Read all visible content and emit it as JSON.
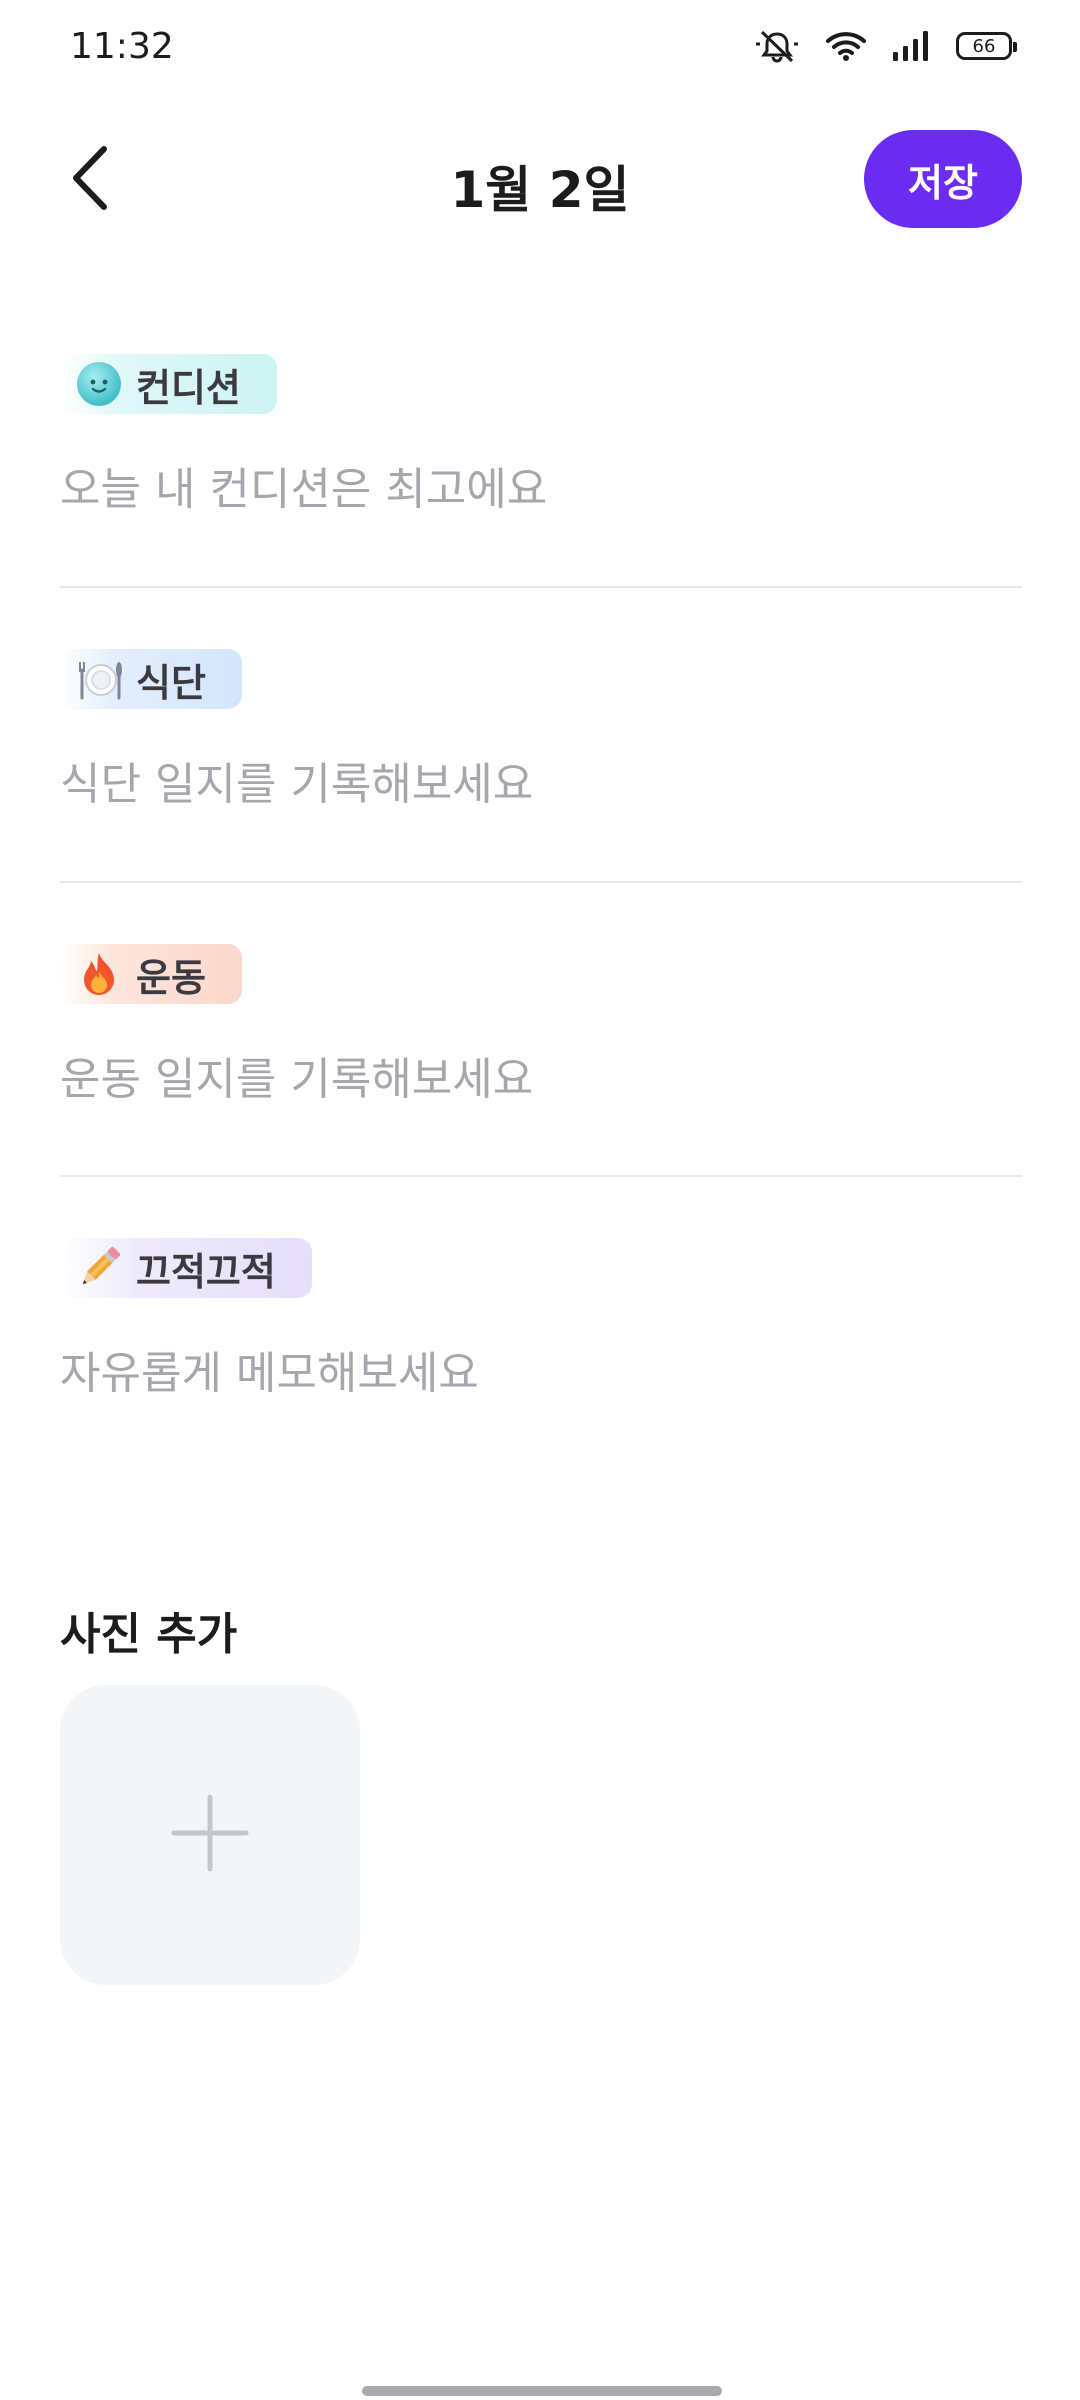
{
  "status_bar": {
    "time": "11:32",
    "battery": "66",
    "icons": [
      "silent-bell-icon",
      "wifi-icon",
      "signal-icon",
      "battery-icon"
    ]
  },
  "header": {
    "title": "1월 2일",
    "save_label": "저장",
    "back_icon": "chevron-left-icon",
    "accent_color": "#6a2cf0"
  },
  "sections": [
    {
      "label": "컨디션",
      "icon": "smiley-face-icon",
      "placeholder": "오늘 내 컨디션은 최고에요",
      "value": ""
    },
    {
      "label": "식단",
      "icon": "fork-plate-icon",
      "placeholder": "식단 일지를 기록해보세요",
      "value": ""
    },
    {
      "label": "운동",
      "icon": "fire-icon",
      "placeholder": "운동 일지를 기록해보세요",
      "value": ""
    },
    {
      "label": "끄적끄적",
      "icon": "pencil-icon",
      "placeholder": "자유롭게 메모해보세요",
      "value": ""
    }
  ],
  "photo": {
    "title": "사진 추가",
    "add_icon": "plus-icon"
  }
}
